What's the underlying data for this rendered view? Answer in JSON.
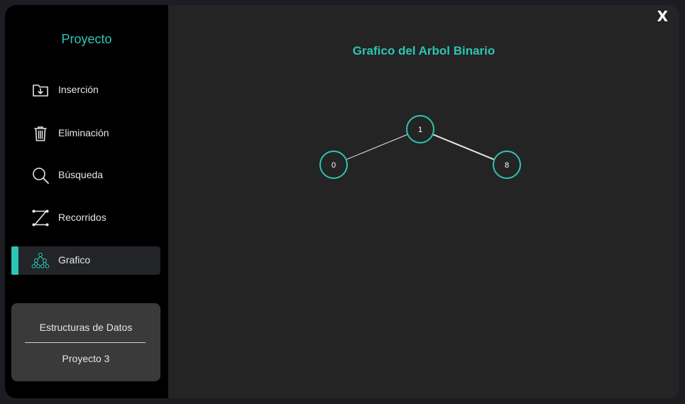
{
  "app": {
    "title": "Proyecto",
    "close_label": "X"
  },
  "sidebar": {
    "items": [
      {
        "label": "Inserción",
        "icon": "folder-download-icon"
      },
      {
        "label": "Eliminación",
        "icon": "trash-icon"
      },
      {
        "label": "Búsqueda",
        "icon": "search-icon"
      },
      {
        "label": "Recorridos",
        "icon": "path-icon"
      },
      {
        "label": "Grafico",
        "icon": "tree-graph-icon",
        "active": true
      }
    ],
    "card": {
      "line1": "Estructuras de Datos",
      "line2": "Proyecto 3"
    }
  },
  "main": {
    "title": "Grafico del Arbol Binario",
    "tree": {
      "nodes": [
        {
          "id": "n1",
          "label": "1"
        },
        {
          "id": "n0",
          "label": "0"
        },
        {
          "id": "n8",
          "label": "8"
        }
      ],
      "edges": [
        {
          "from": "n1",
          "to": "n0"
        },
        {
          "from": "n1",
          "to": "n8"
        }
      ]
    }
  },
  "colors": {
    "accent": "#2ec4b6",
    "sidebar_bg": "#000000",
    "main_bg": "#242424",
    "card_bg": "#3a3a3a",
    "active_bg": "#222427"
  }
}
